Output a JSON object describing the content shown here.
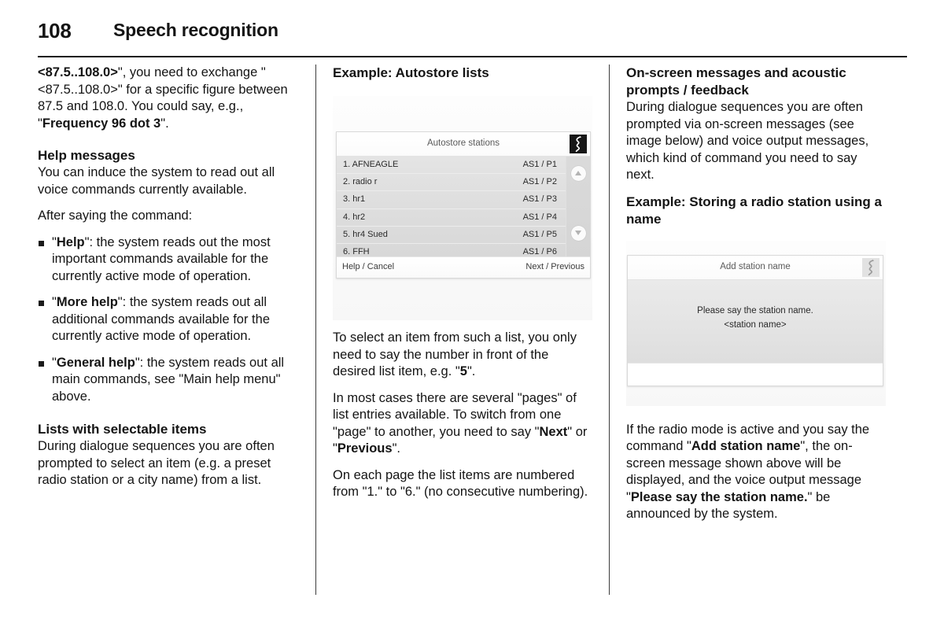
{
  "header": {
    "page_number": "108",
    "title": "Speech recognition"
  },
  "column1": {
    "intro_para": {
      "bold_lead": "<87.5..108.0>",
      "rest": "\", you need to exchange \"<87.5..108.0>\" for a specific figure between 87.5 and 108.0. You could say, e.g., \"",
      "bold_example": "Frequency 96 dot 3",
      "tail": "\"."
    },
    "help_messages": {
      "heading": "Help messages",
      "para1": "You can induce the system to read out all voice commands currently available.",
      "para2": "After saying the command:",
      "bullets": [
        {
          "open_quote": "\"",
          "command": "Help",
          "text": "\": the system reads out the most important commands available for the currently active mode of operation."
        },
        {
          "open_quote": "\"",
          "command": "More help",
          "text": "\": the system reads out all additional commands available for the currently active mode of operation."
        },
        {
          "open_quote": "\"",
          "command": "General help",
          "text": "\": the system reads out all main commands, see \"Main help menu\" above."
        }
      ]
    },
    "lists_section": {
      "heading": "Lists with selectable items",
      "para1": "During dialogue sequences you are often prompted to select an item (e.g. a preset radio station or a city name) from a list."
    }
  },
  "column2": {
    "heading": "Example: Autostore lists",
    "device": {
      "title": "Autostore stations",
      "speech_icon_name": "speech-recognition-icon",
      "rows": [
        {
          "name": "1. AFNEAGLE",
          "preset": "AS1 / P1"
        },
        {
          "name": "2. radio r",
          "preset": "AS1 / P2"
        },
        {
          "name": "3. hr1",
          "preset": "AS1 / P3"
        },
        {
          "name": "4. hr2",
          "preset": "AS1 / P4"
        },
        {
          "name": "5. hr4 Sued",
          "preset": "AS1 / P5"
        },
        {
          "name": "6. FFH",
          "preset": "AS1 / P6"
        }
      ],
      "footer_left": "Help / Cancel",
      "footer_right": "Next / Previous"
    },
    "para1_a": "To select an item from such a list, you only need to say the number in front of the desired list item, e.g. \"",
    "para1_bold": "5",
    "para1_b": "\".",
    "para2_a": "In most cases there are several \"pages\" of list entries available. To switch from one \"page\" to another, you need to say \"",
    "para2_bold1": "Next",
    "para2_mid": "\" or \"",
    "para2_bold2": "Previous",
    "para2_b": "\".",
    "para3": "On each page the list items are numbered from \"1.\" to \"6.\" (no consecutive numbering)."
  },
  "column3": {
    "heading1": "On-screen messages and acoustic prompts / feedback",
    "para1": "During dialogue sequences you are often prompted via on-screen messages (see image below) and voice output messages, which kind of command you need to say next.",
    "heading2": "Example: Storing a radio station using a name",
    "device": {
      "title": "Add station name",
      "speech_icon_name": "speech-recognition-icon",
      "message_line1": "Please say the station name.",
      "message_line2": "<station name>"
    },
    "para2_a": "If the radio mode is active and you say the command \"",
    "para2_bold1": "Add station name",
    "para2_mid": "\", the on-screen message shown above will be displayed, and the voice output message \"",
    "para2_bold2": "Please say the station name.",
    "para2_b": "\" be announced by the system."
  }
}
